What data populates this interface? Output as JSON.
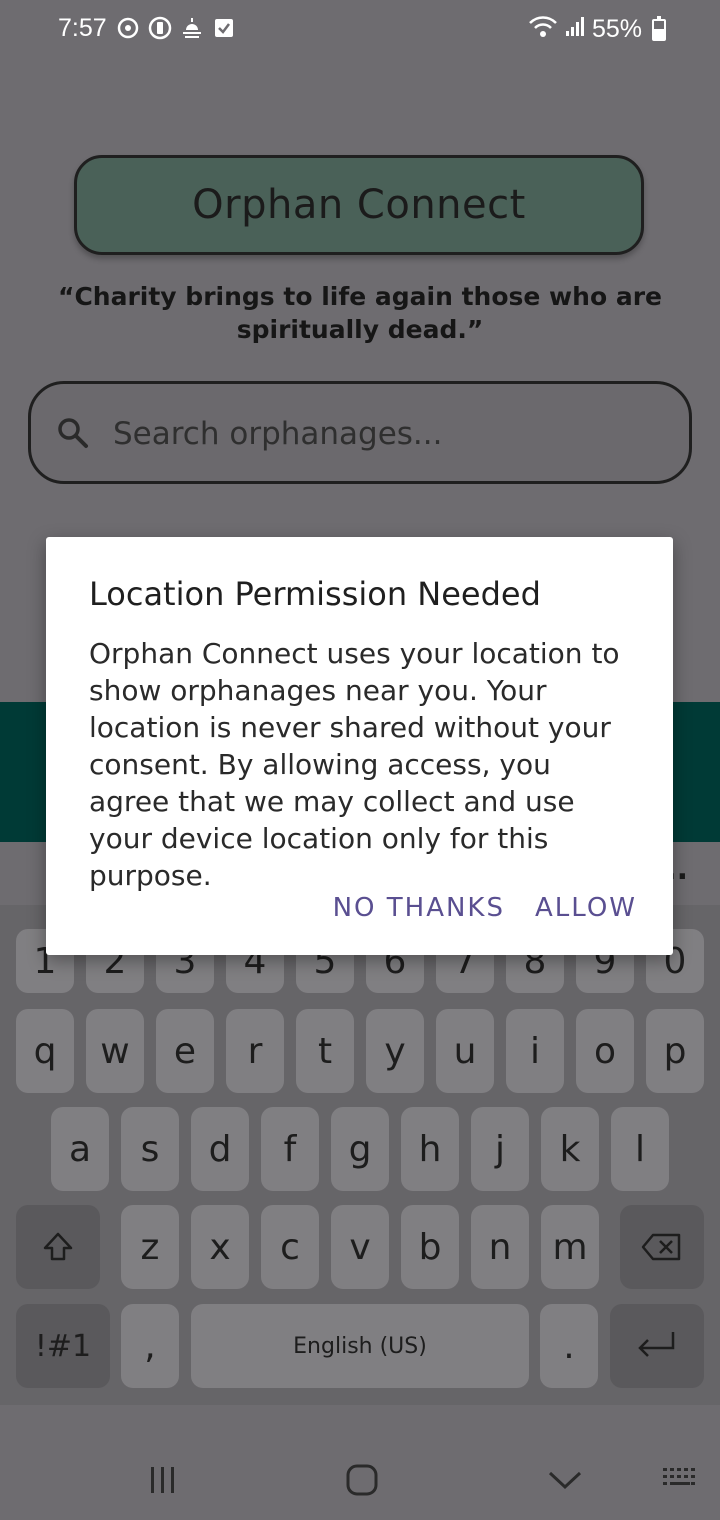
{
  "status_bar": {
    "time": "7:57",
    "battery": "55%",
    "left_icons": [
      "sync-icon",
      "vibrate-icon",
      "weather-icon",
      "checkbox-icon"
    ],
    "right_icons": [
      "wifi-icon",
      "signal-icon",
      "battery-icon"
    ]
  },
  "app": {
    "title": "Orphan Connect",
    "quote": "“Charity brings to life again those who are spiritually dead.”",
    "search_placeholder": "Search orphanages...",
    "overflow": "..."
  },
  "dialog": {
    "title": "Location Permission Needed",
    "body": "Orphan Connect uses your location to show orphanages near you. Your location is never shared without your consent. By allowing access, you agree that we may collect and use your device location only for this purpose.",
    "negative": "NO THANKS",
    "positive": "ALLOW"
  },
  "keyboard": {
    "numbers": [
      "1",
      "2",
      "3",
      "4",
      "5",
      "6",
      "7",
      "8",
      "9",
      "0"
    ],
    "row1": [
      "q",
      "w",
      "e",
      "r",
      "t",
      "y",
      "u",
      "i",
      "o",
      "p"
    ],
    "row2": [
      "a",
      "s",
      "d",
      "f",
      "g",
      "h",
      "j",
      "k",
      "l"
    ],
    "row3": [
      "z",
      "x",
      "c",
      "v",
      "b",
      "n",
      "m"
    ],
    "symbols": "!#1",
    "comma": ",",
    "space": "English (US)",
    "period": "."
  },
  "colors": {
    "scrim_background": "#6e6c70",
    "title_box": "#4a6158",
    "teal_band": "#003a36",
    "dialog_button": "#5a4f91"
  }
}
